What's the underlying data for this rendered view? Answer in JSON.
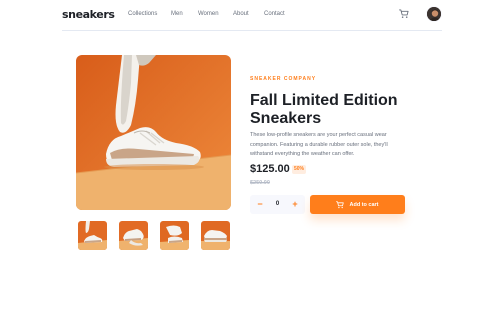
{
  "header": {
    "logo": "sneakers",
    "nav": [
      "Collections",
      "Men",
      "Women",
      "About",
      "Contact"
    ],
    "cart_icon": "cart-icon",
    "avatar_icon": "user-avatar"
  },
  "gallery": {
    "thumbnails_count": 4
  },
  "product": {
    "company": "SNEAKER COMPANY",
    "title": "Fall Limited Edition Sneakers",
    "description": "These low-profile sneakers are your perfect casual wear companion. Featuring a durable rubber outer sole, they'll withstand everything the weather can offer.",
    "price": "$125.00",
    "discount": "50%",
    "original_price": "$250.00"
  },
  "cart_controls": {
    "minus_label": "−",
    "quantity": "0",
    "plus_label": "+",
    "add_to_cart_label": "Add to cart",
    "cart_icon": "cart-icon"
  },
  "colors": {
    "accent": "#ff7e1b",
    "accent_pale": "#ffede0",
    "dark": "#1d2026",
    "grey": "#69707d",
    "light_grey": "#b6bcc8",
    "photo_bg": "#e26a24"
  }
}
